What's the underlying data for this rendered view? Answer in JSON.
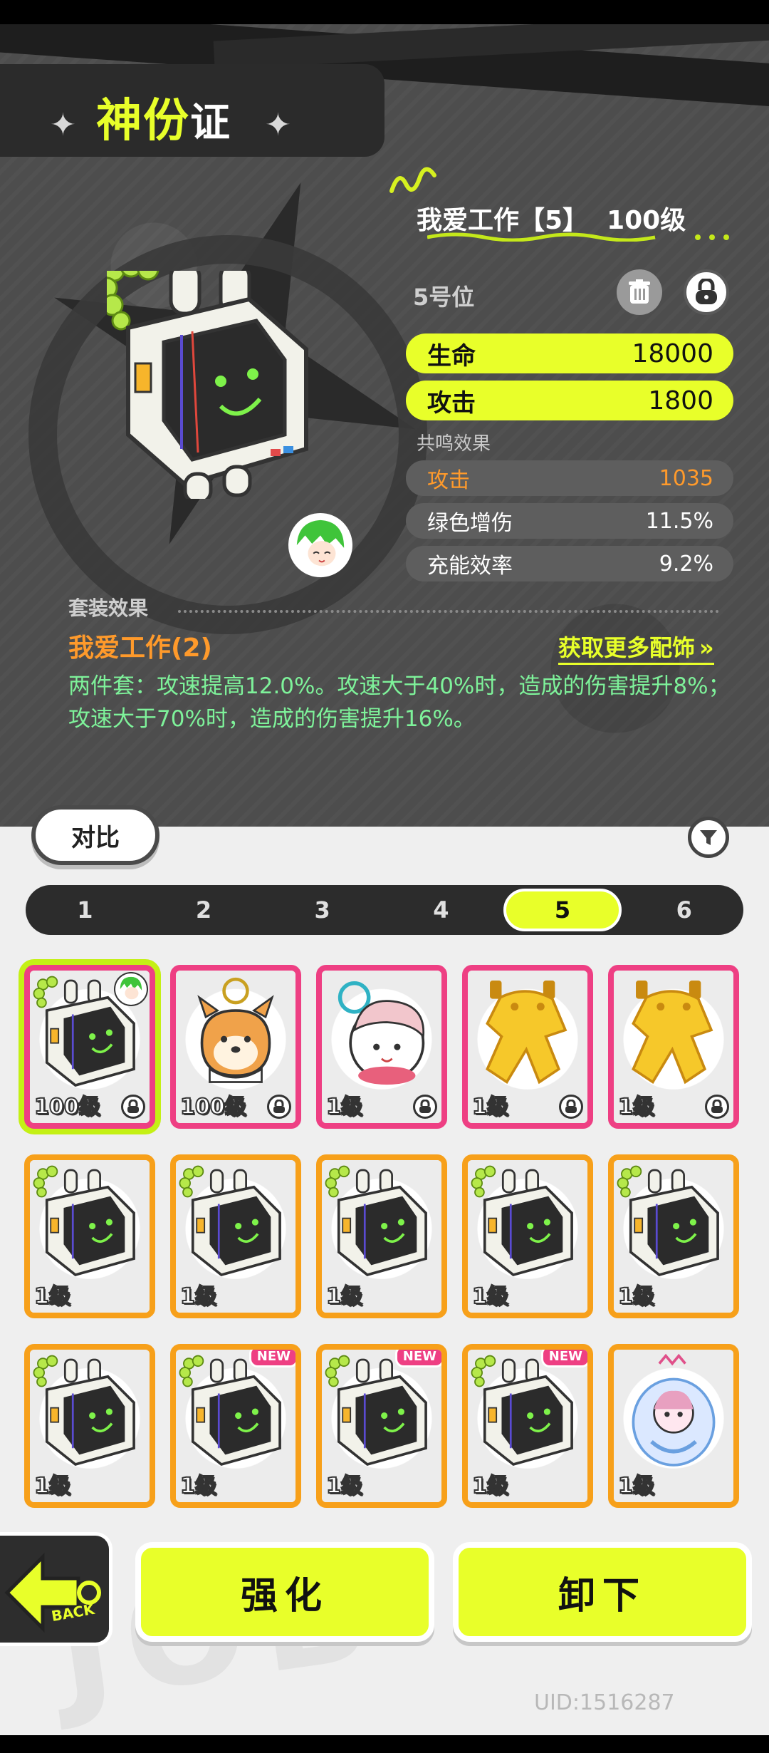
{
  "header": {
    "title_a": "神份",
    "title_b": "证"
  },
  "equip": {
    "name": "我爱工作【5】",
    "level": "100级",
    "slot": "5号位",
    "main_stats": [
      {
        "label": "生命",
        "value": "18000"
      },
      {
        "label": "攻击",
        "value": "1800"
      }
    ],
    "resonance_label": "共鸣效果",
    "sub_stats": [
      {
        "label": "攻击",
        "value": "1035",
        "color": "#ff9a2b"
      },
      {
        "label": "绿色增伤",
        "value": "11.5%"
      },
      {
        "label": "充能效率",
        "value": "9.2%"
      }
    ]
  },
  "set": {
    "label": "套装效果",
    "name": "我爱工作(2)",
    "more_link": "获取更多配饰",
    "description": "两件套：攻速提高12.0%。攻速大于40%时，造成的伤害提升8%；攻速大于70%时，造成的伤害提升16%。"
  },
  "toolbar": {
    "compare": "对比"
  },
  "slot_tabs": [
    "1",
    "2",
    "3",
    "4",
    "5",
    "6"
  ],
  "active_slot": "5",
  "inventory": [
    {
      "level": "100级",
      "frame": "pink",
      "art": "monitor-keychain",
      "locked": true,
      "equipped": true
    },
    {
      "level": "100级",
      "frame": "pink",
      "art": "dog-keychain",
      "locked": true
    },
    {
      "level": "1级",
      "frame": "pink",
      "art": "girl-keychain",
      "locked": true
    },
    {
      "level": "1级",
      "frame": "pink",
      "art": "frog-keychain",
      "locked": true
    },
    {
      "level": "1级",
      "frame": "pink",
      "art": "frog-keychain",
      "locked": true
    },
    {
      "level": "1级",
      "frame": "orange",
      "art": "monitor-keychain"
    },
    {
      "level": "1级",
      "frame": "orange",
      "art": "monitor-keychain"
    },
    {
      "level": "1级",
      "frame": "orange",
      "art": "monitor-keychain"
    },
    {
      "level": "1级",
      "frame": "orange",
      "art": "monitor-keychain"
    },
    {
      "level": "1级",
      "frame": "orange",
      "art": "monitor-keychain"
    },
    {
      "level": "1级",
      "frame": "orange",
      "art": "monitor-keychain"
    },
    {
      "level": "1级",
      "frame": "orange",
      "art": "monitor-keychain",
      "new": "NEW"
    },
    {
      "level": "1级",
      "frame": "orange",
      "art": "monitor-keychain",
      "new": "NEW"
    },
    {
      "level": "1级",
      "frame": "orange",
      "art": "monitor-keychain",
      "new": "NEW"
    },
    {
      "level": "1级",
      "frame": "orange",
      "art": "maid-keychain"
    }
  ],
  "actions": {
    "back": "BACK",
    "enhance": "强化",
    "unequip": "卸下"
  },
  "footer": {
    "uid": "UID:1516287"
  },
  "colors": {
    "accent": "#e8ff2a",
    "pink_frame": "#ee3f83",
    "orange_frame": "#f7a01a"
  }
}
